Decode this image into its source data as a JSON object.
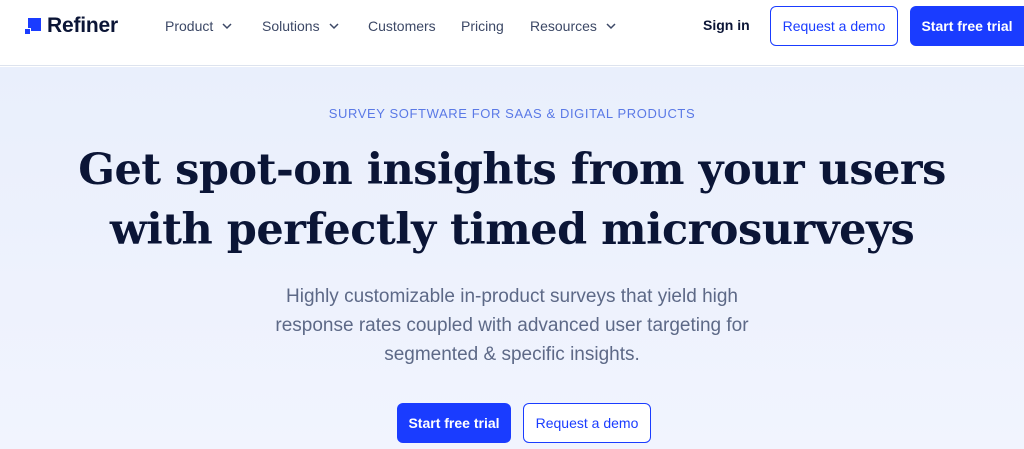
{
  "brand": {
    "name": "Refiner",
    "accent": "#1a3cff",
    "text": "#0b1536"
  },
  "nav": {
    "items": [
      {
        "label": "Product",
        "has_dropdown": true
      },
      {
        "label": "Solutions",
        "has_dropdown": true
      },
      {
        "label": "Customers",
        "has_dropdown": false
      },
      {
        "label": "Pricing",
        "has_dropdown": false
      },
      {
        "label": "Resources",
        "has_dropdown": true
      }
    ],
    "sign_in": "Sign in",
    "request_demo": "Request a demo",
    "start_trial": "Start free trial"
  },
  "hero": {
    "eyebrow": "SURVEY SOFTWARE FOR SAAS & DIGITAL PRODUCTS",
    "headline_line1": "Get spot-on insights from your users",
    "headline_line2": "with perfectly timed microsurveys",
    "subhead_line1": "Highly customizable in-product surveys that yield high",
    "subhead_line2": "response rates coupled with advanced user targeting for",
    "subhead_line3": "segmented & specific insights.",
    "primary_cta": "Start free trial",
    "secondary_cta": "Request a demo"
  },
  "icons": {
    "logo": "refiner-logo-icon",
    "dropdown": "chevron-down-icon"
  }
}
